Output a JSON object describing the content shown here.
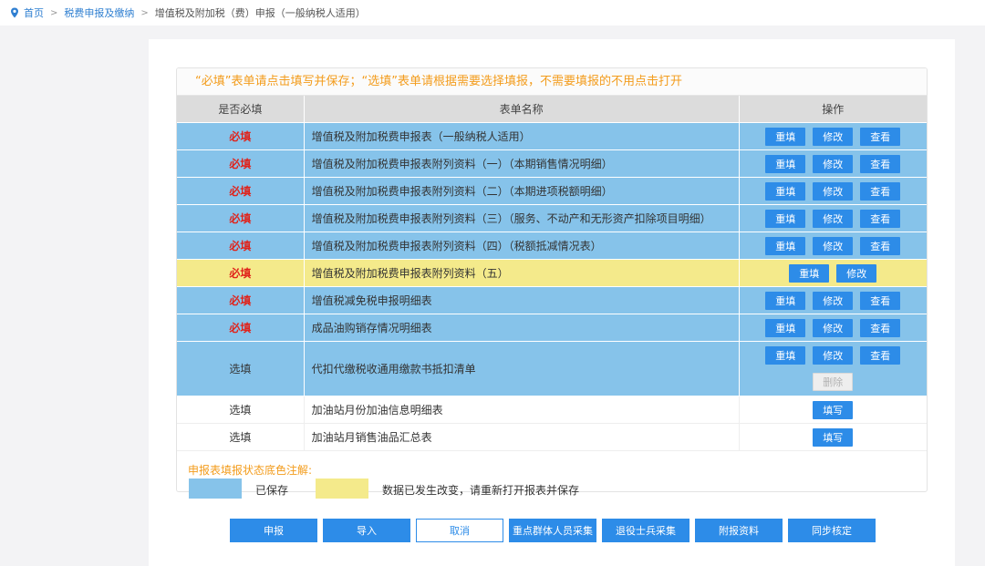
{
  "breadcrumb": {
    "home": "首页",
    "level2": "税费申报及缴纳",
    "current": "增值税及附加税（费）申报（一般纳税人适用）"
  },
  "notice": "“必填”表单请点击填写并保存；“选填”表单请根据需要选择填报，不需要填报的不用点击打开",
  "table": {
    "headers": [
      "是否必填",
      "表单名称",
      "操作"
    ],
    "rows": [
      {
        "required": "必填",
        "name": "增值税及附加税费申报表（一般纳税人适用）",
        "buttons": [
          "重填",
          "修改",
          "查看"
        ]
      },
      {
        "required": "必填",
        "name": "增值税及附加税费申报表附列资料（一）（本期销售情况明细）",
        "buttons": [
          "重填",
          "修改",
          "查看"
        ]
      },
      {
        "required": "必填",
        "name": "增值税及附加税费申报表附列资料（二）（本期进项税额明细）",
        "buttons": [
          "重填",
          "修改",
          "查看"
        ]
      },
      {
        "required": "必填",
        "name": "增值税及附加税费申报表附列资料（三）（服务、不动产和无形资产扣除项目明细）",
        "buttons": [
          "重填",
          "修改",
          "查看"
        ]
      },
      {
        "required": "必填",
        "name": "增值税及附加税费申报表附列资料（四）（税额抵减情况表）",
        "buttons": [
          "重填",
          "修改",
          "查看"
        ]
      },
      {
        "required": "必填",
        "name": "增值税及附加税费申报表附列资料（五）",
        "buttons": [
          "重填",
          "修改"
        ]
      },
      {
        "required": "必填",
        "name": "增值税减免税申报明细表",
        "buttons": [
          "重填",
          "修改",
          "查看"
        ]
      },
      {
        "required": "必填",
        "name": "成品油购销存情况明细表",
        "buttons": [
          "重填",
          "修改",
          "查看"
        ]
      },
      {
        "required": "选填",
        "name": "代扣代缴税收通用缴款书抵扣清单",
        "buttons": [
          "重填",
          "修改",
          "查看"
        ],
        "extra_button": "删除"
      },
      {
        "required": "选填",
        "name": "加油站月份加油信息明细表",
        "buttons": [
          "填写"
        ]
      },
      {
        "required": "选填",
        "name": "加油站月销售油品汇总表",
        "buttons": [
          "填写"
        ]
      }
    ]
  },
  "legend": {
    "title": "申报表填报状态底色注解:",
    "saved": "已保存",
    "changed": "数据已发生改变，请重新打开报表并保存"
  },
  "actions": [
    "申报",
    "导入",
    "取消",
    "重点群体人员采集",
    "退役士兵采集",
    "附报资料",
    "同步核定"
  ],
  "colors": {
    "accent": "#2d8ce8",
    "saved_row": "#86c3ea",
    "changed_row": "#f4ea8b",
    "required_text": "#e0231b",
    "notice_text": "#f39c1c"
  }
}
